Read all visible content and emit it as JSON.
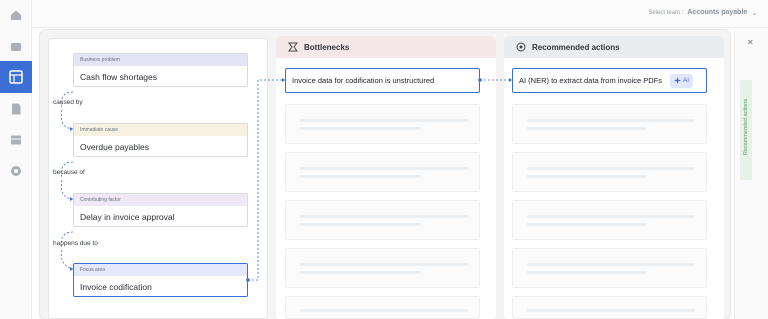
{
  "team_selector": {
    "label": "Select team :",
    "value": "Accounts payable"
  },
  "rail_icons": [
    "home-icon",
    "inbox-icon",
    "dashboard-icon",
    "document-icon",
    "table-icon",
    "settings-icon"
  ],
  "causal_chain": [
    {
      "tag": "Business problem",
      "text": "Cash flow shortages",
      "tag_color": "#e3e5f5"
    },
    {
      "relation": "caused by"
    },
    {
      "tag": "Immediate cause",
      "text": "Overdue payables",
      "tag_color": "#f6f1e1"
    },
    {
      "relation": "because of"
    },
    {
      "tag": "Contributing factor",
      "text": "Delay in invoice approval",
      "tag_color": "#efe8f6"
    },
    {
      "relation": "happens due to"
    },
    {
      "tag": "Focus area",
      "text": "Invoice codification",
      "tag_color": "#e3e9fa"
    }
  ],
  "bottlenecks": {
    "title": "Bottlenecks",
    "icon": "bottleneck-icon",
    "items": [
      "Invoice data for codification is unstructured"
    ]
  },
  "recommended_actions": {
    "title": "Recommended actions",
    "icon": "target-icon",
    "items": [
      {
        "text": "AI (NER) to extract data from invoice PDFs",
        "badge": "AI"
      }
    ]
  },
  "side_panel": {
    "tab_label": "Recommended actions",
    "close_icon": "close-icon"
  },
  "colors": {
    "accent": "#3b6fd6",
    "bottleneck_header": "#f6e8e8",
    "actions_header": "#e9edef"
  }
}
